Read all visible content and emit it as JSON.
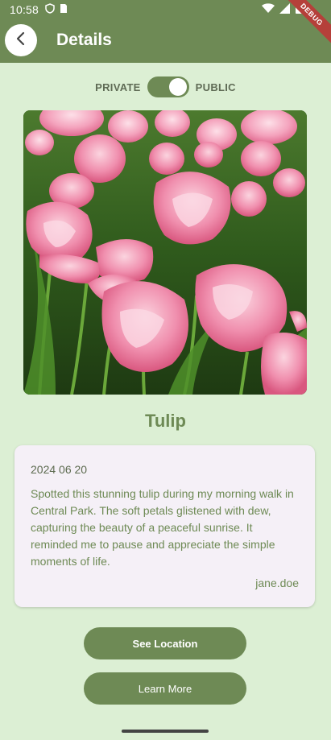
{
  "status_bar": {
    "time": "10:58",
    "left_icons": [
      "shield-icon",
      "sim-card-icon"
    ],
    "right_icons": [
      "wifi-icon",
      "signal-icon",
      "battery-icon"
    ],
    "debug_label": "DEBUG"
  },
  "header": {
    "title": "Details",
    "back_icon": "chevron-left-icon"
  },
  "privacy": {
    "left_label": "PRIVATE",
    "right_label": "PUBLIC",
    "is_public": true
  },
  "post": {
    "image_alt": "pink-tulips-photo",
    "name": "Tulip",
    "date": "2024 06 20",
    "description": "Spotted this stunning tulip during my morning walk in Central Park. The soft petals glistened with dew, capturing the beauty of a peaceful sunrise. It reminded me to pause and appreciate the simple moments of life.",
    "author": "jane.doe"
  },
  "actions": {
    "see_location": "See Location",
    "learn_more": "Learn More"
  },
  "colors": {
    "primary": "#6e8a55",
    "background": "#dcefd4",
    "card": "#f5f0f7"
  }
}
